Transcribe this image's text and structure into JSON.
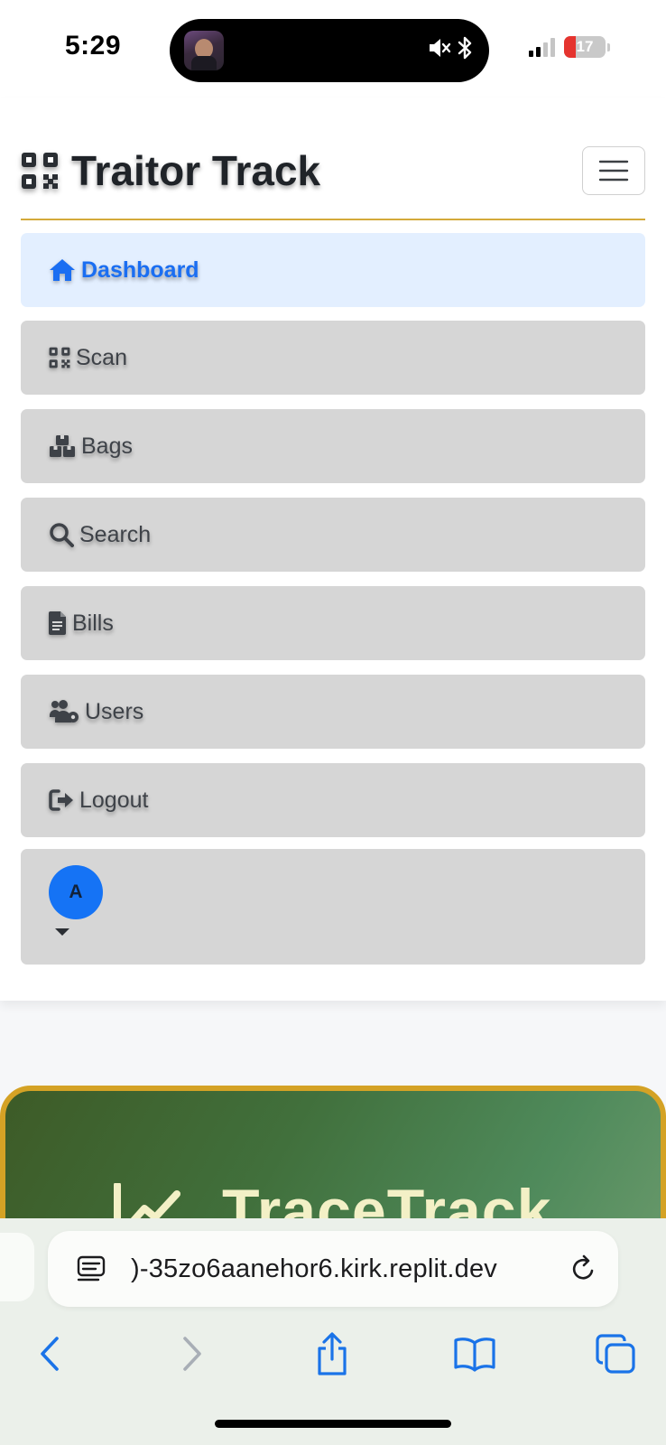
{
  "status_bar": {
    "time": "5:29",
    "battery": "17"
  },
  "app": {
    "brand": "Traitor Track"
  },
  "nav": {
    "items": [
      {
        "label": "Dashboard",
        "icon": "home-icon",
        "active": true
      },
      {
        "label": "Scan",
        "icon": "qrcode-icon",
        "active": false
      },
      {
        "label": "Bags",
        "icon": "boxes-icon",
        "active": false
      },
      {
        "label": "Search",
        "icon": "search-icon",
        "active": false
      },
      {
        "label": "Bills",
        "icon": "file-invoice-icon",
        "active": false
      },
      {
        "label": "Users",
        "icon": "users-cog-icon",
        "active": false
      },
      {
        "label": "Logout",
        "icon": "sign-out-icon",
        "active": false
      }
    ],
    "user": {
      "avatar_initial": "A"
    }
  },
  "hero": {
    "title": "TraceTrack"
  },
  "browser": {
    "url": ")-35zo6aanehor6.kirk.replit.dev"
  },
  "colors": {
    "accent": "#1a6ef2",
    "gold": "#d4a93a",
    "hero_green": "#41703c"
  }
}
